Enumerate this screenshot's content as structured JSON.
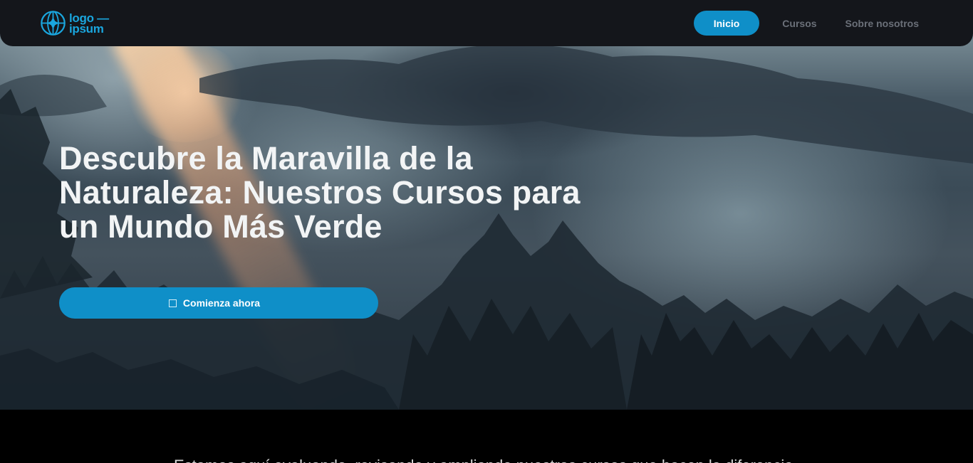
{
  "brand": {
    "logo_line1": "logo",
    "logo_line2": "ipsum",
    "accent_color": "#0f8fc8"
  },
  "nav": {
    "items": [
      {
        "label": "Inicio",
        "active": true
      },
      {
        "label": "Cursos",
        "active": false
      },
      {
        "label": "Sobre nosotros",
        "active": false
      }
    ]
  },
  "hero": {
    "title": "Descubre la Maravilla de la Naturaleza: Nuestros Cursos para un Mundo Más Verde",
    "cta_label": "Comienza ahora",
    "cta_icon": "square-icon"
  },
  "intro": {
    "text": "Estamos aquí evaluando, revisando y ampliando nuestros cursos que hacen la diferencia."
  }
}
